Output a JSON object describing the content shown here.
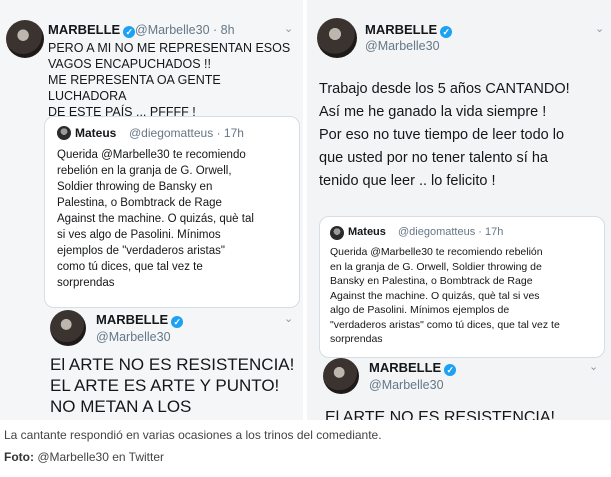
{
  "left": {
    "author": {
      "name": "MARBELLE",
      "handle": "@Marbelle30",
      "time": "8h"
    },
    "text": "PERO A MI NO ME REPRESENTAN ESOS\nVAGOS ENCAPUCHADOS !!\nME REPRESENTA OA GENTE LUCHADORA\nDE ESTE PAÍS ... PFFFF !",
    "quote": {
      "name": "Mateus",
      "handle": "@diegomatteus",
      "time": "17h",
      "text": "Querida @Marbelle30 te recomiendo\nrebelión en la granja de G. Orwell,\nSoldier throwing de Bansky en\nPalestina, o Bombtrack de Rage\nAgainst the machine. O quizás, què tal\nsi ves algo de Pasolini. Mínimos\nejemplos de \"verdaderos aristas\"\ncomo tú dices, que tal vez te\nsorprendas"
    },
    "embedded": {
      "name": "MARBELLE",
      "handle": "@Marbelle30",
      "text": "El ARTE NO ES RESISTENCIA!\nEL ARTE ES ARTE Y PUNTO!\nNO METAN A LOS"
    }
  },
  "right": {
    "author": {
      "name": "MARBELLE",
      "handle": "@Marbelle30"
    },
    "text": "Trabajo desde los 5 años CANTANDO!\nAsí me he ganado la vida siempre !\nPor eso no tuve tiempo de leer todo lo\nque usted por no tener talento sí ha\ntenido que leer .. lo felicito !",
    "quote": {
      "name": "Mateus",
      "handle": "@diegomatteus",
      "time": "17h",
      "text": "Querida @Marbelle30 te recomiendo rebelión\nen la granja de G. Orwell, Soldier throwing de\nBansky en Palestina, o Bombtrack de Rage\nAgainst the machine. O quizás, què tal si ves\nalgo de Pasolini. Mínimos ejemplos de\n\"verdaderos aristas\" como tú dices, que tal vez te\nsorprendas"
    },
    "embedded": {
      "name": "MARBELLE",
      "handle": "@Marbelle30",
      "text": "El ARTE NO ES RESISTENCIA!"
    }
  },
  "caption": "La cantante respondió en varias ocasiones a los trinos del comediante.",
  "credit": {
    "label": "Foto:",
    "value": "@Marbelle30 en Twitter"
  },
  "icons": {
    "verified": "verified-check-icon",
    "chevron": "chevron-down-icon"
  },
  "colors": {
    "verified": "#1da1f2",
    "handle": "#657786",
    "text": "#14171a"
  }
}
